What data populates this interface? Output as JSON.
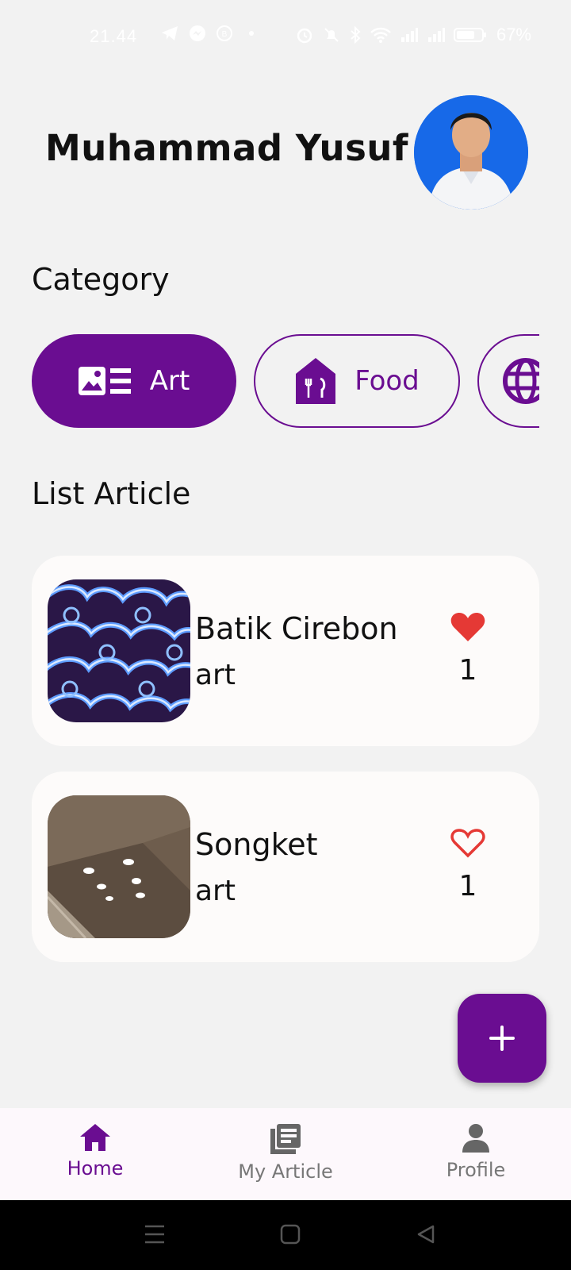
{
  "status_bar": {
    "time": "21.44",
    "battery": "67%"
  },
  "header": {
    "user_name": "Muhammad Yusuf ..."
  },
  "category_section": {
    "title": "Category",
    "chips": [
      {
        "label": "Art",
        "icon": "art-icon",
        "active": true
      },
      {
        "label": "Food",
        "icon": "food-icon",
        "active": false
      },
      {
        "label": "",
        "icon": "globe-icon",
        "active": false
      }
    ]
  },
  "list_section": {
    "title": "List Article",
    "articles": [
      {
        "title": "Batik Cirebon",
        "category": "art",
        "likes": "1",
        "liked": true,
        "thumbnail": "batik-image"
      },
      {
        "title": "Songket",
        "category": "art",
        "likes": "1",
        "liked": false,
        "thumbnail": "ceiling-image"
      }
    ]
  },
  "fab": {
    "icon": "plus-icon"
  },
  "bottom_nav": {
    "items": [
      {
        "label": "Home",
        "icon": "home-icon",
        "active": true
      },
      {
        "label": "My Article",
        "icon": "article-icon",
        "active": false
      },
      {
        "label": "Profile",
        "icon": "person-icon",
        "active": false
      }
    ]
  },
  "colors": {
    "primary": "#6a0d91",
    "like": "#e53935",
    "background": "#f2f2f2",
    "card": "#fdfbfa",
    "inactive_nav": "#777777"
  }
}
